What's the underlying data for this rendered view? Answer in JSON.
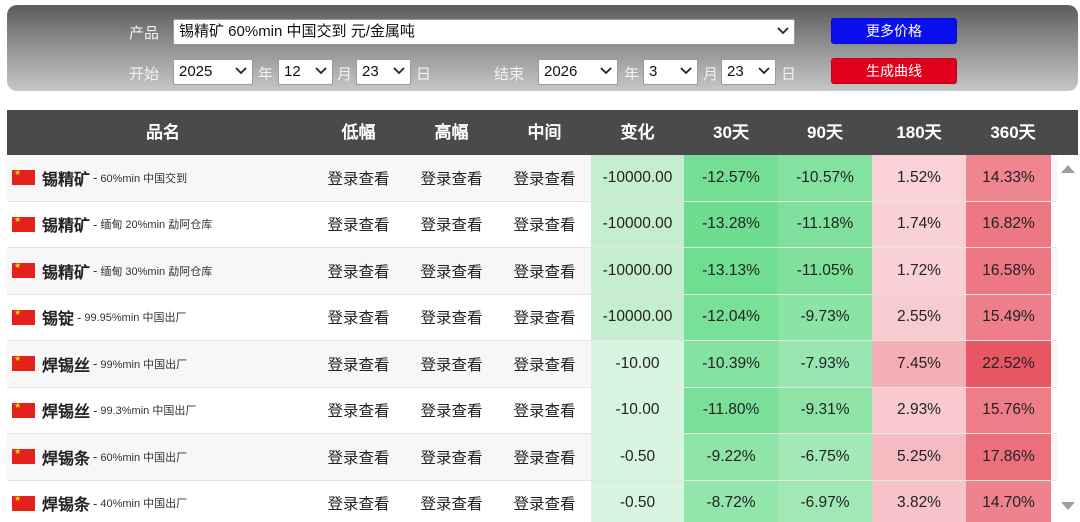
{
  "filters": {
    "product_label": "产品",
    "product_value": "锡精矿 60%min 中国交到 元/金属吨",
    "start_label": "开始",
    "start_year": "2025",
    "start_month": "12",
    "start_day": "23",
    "end_label": "结束",
    "end_year": "2026",
    "end_month": "3",
    "end_day": "23",
    "year_unit": "年",
    "month_unit": "月",
    "day_unit": "日",
    "more_prices_label": "更多价格",
    "generate_curve_label": "生成曲线"
  },
  "table": {
    "headers": [
      "品名",
      "低幅",
      "高幅",
      "中间",
      "变化",
      "30天",
      "90天",
      "180天",
      "360天"
    ],
    "login_text": "登录查看",
    "rows": [
      {
        "name": "锡精矿",
        "spec": "60%min 中国交到",
        "change": "-10000.00",
        "d30": "-12.57%",
        "d90": "-10.57%",
        "d180": "1.52%",
        "d360": "14.33%"
      },
      {
        "name": "锡精矿",
        "spec": "缅甸 20%min 勐阿仓库",
        "change": "-10000.00",
        "d30": "-13.28%",
        "d90": "-11.18%",
        "d180": "1.74%",
        "d360": "16.82%"
      },
      {
        "name": "锡精矿",
        "spec": "缅甸 30%min 勐阿仓库",
        "change": "-10000.00",
        "d30": "-13.13%",
        "d90": "-11.05%",
        "d180": "1.72%",
        "d360": "16.58%"
      },
      {
        "name": "锡锭",
        "spec": "99.95%min 中国出厂",
        "change": "-10000.00",
        "d30": "-12.04%",
        "d90": "-9.73%",
        "d180": "2.55%",
        "d360": "15.49%"
      },
      {
        "name": "焊锡丝",
        "spec": "99%min 中国出厂",
        "change": "-10.00",
        "d30": "-10.39%",
        "d90": "-7.93%",
        "d180": "7.45%",
        "d360": "22.52%"
      },
      {
        "name": "焊锡丝",
        "spec": "99.3%min 中国出厂",
        "change": "-10.00",
        "d30": "-11.80%",
        "d90": "-9.31%",
        "d180": "2.93%",
        "d360": "15.76%"
      },
      {
        "name": "焊锡条",
        "spec": "60%min 中国出厂",
        "change": "-0.50",
        "d30": "-9.22%",
        "d90": "-6.75%",
        "d180": "5.25%",
        "d360": "17.86%"
      },
      {
        "name": "焊锡条",
        "spec": "40%min 中国出厂",
        "change": "-0.50",
        "d30": "-8.72%",
        "d90": "-6.97%",
        "d180": "3.82%",
        "d360": "14.70%"
      }
    ]
  },
  "colors": {
    "header_bg": "#4a4a4a",
    "button_blue": "#0a0ff0",
    "button_red": "#e0001c",
    "negative_green": "#6fdc8c",
    "positive_red": "#e85a68"
  }
}
